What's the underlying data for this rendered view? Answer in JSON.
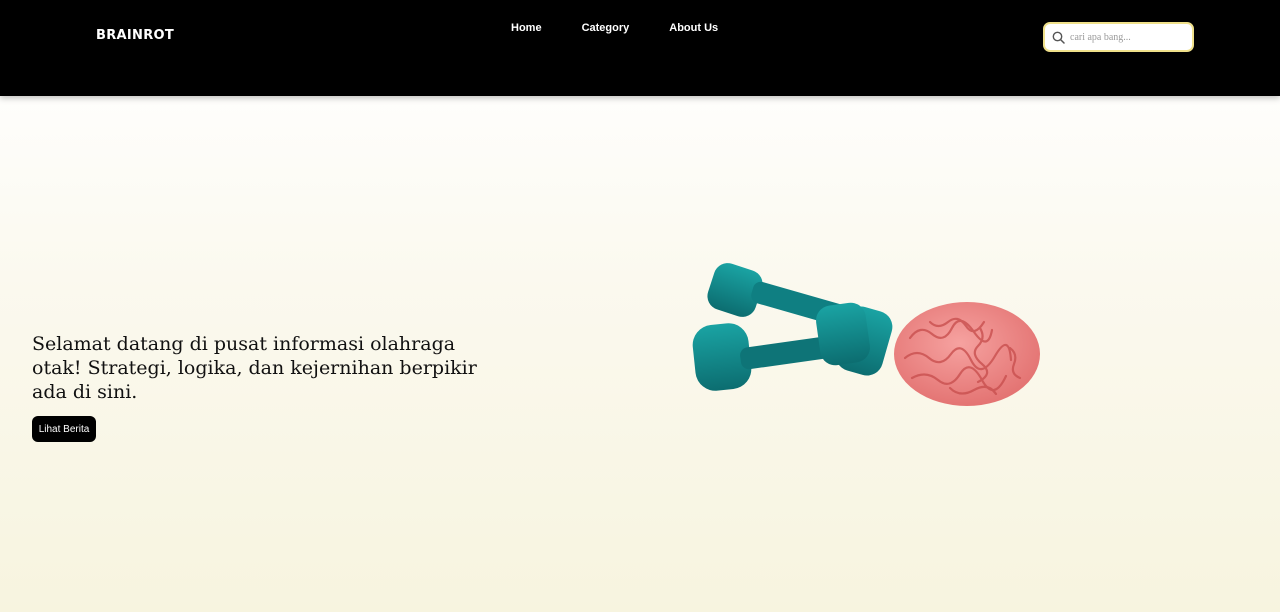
{
  "navbar": {
    "brand": "BRAINROT",
    "links": [
      "Home",
      "Category",
      "About Us"
    ],
    "search": {
      "placeholder": "cari apa bang...",
      "icon": "search-icon"
    }
  },
  "hero": {
    "headline": "Selamat datang di pusat informasi olahraga otak! Strategi, logika, dan kejernihan berpikir ada di sini.",
    "button_label": "Lihat Berita",
    "image": "dumbbells-and-brain-illustration"
  },
  "colors": {
    "navbar_bg": "#000000",
    "search_border": "#efe08a",
    "dumbbell": "#13898c",
    "brain": "#f08b8b",
    "button_bg": "#000000"
  }
}
